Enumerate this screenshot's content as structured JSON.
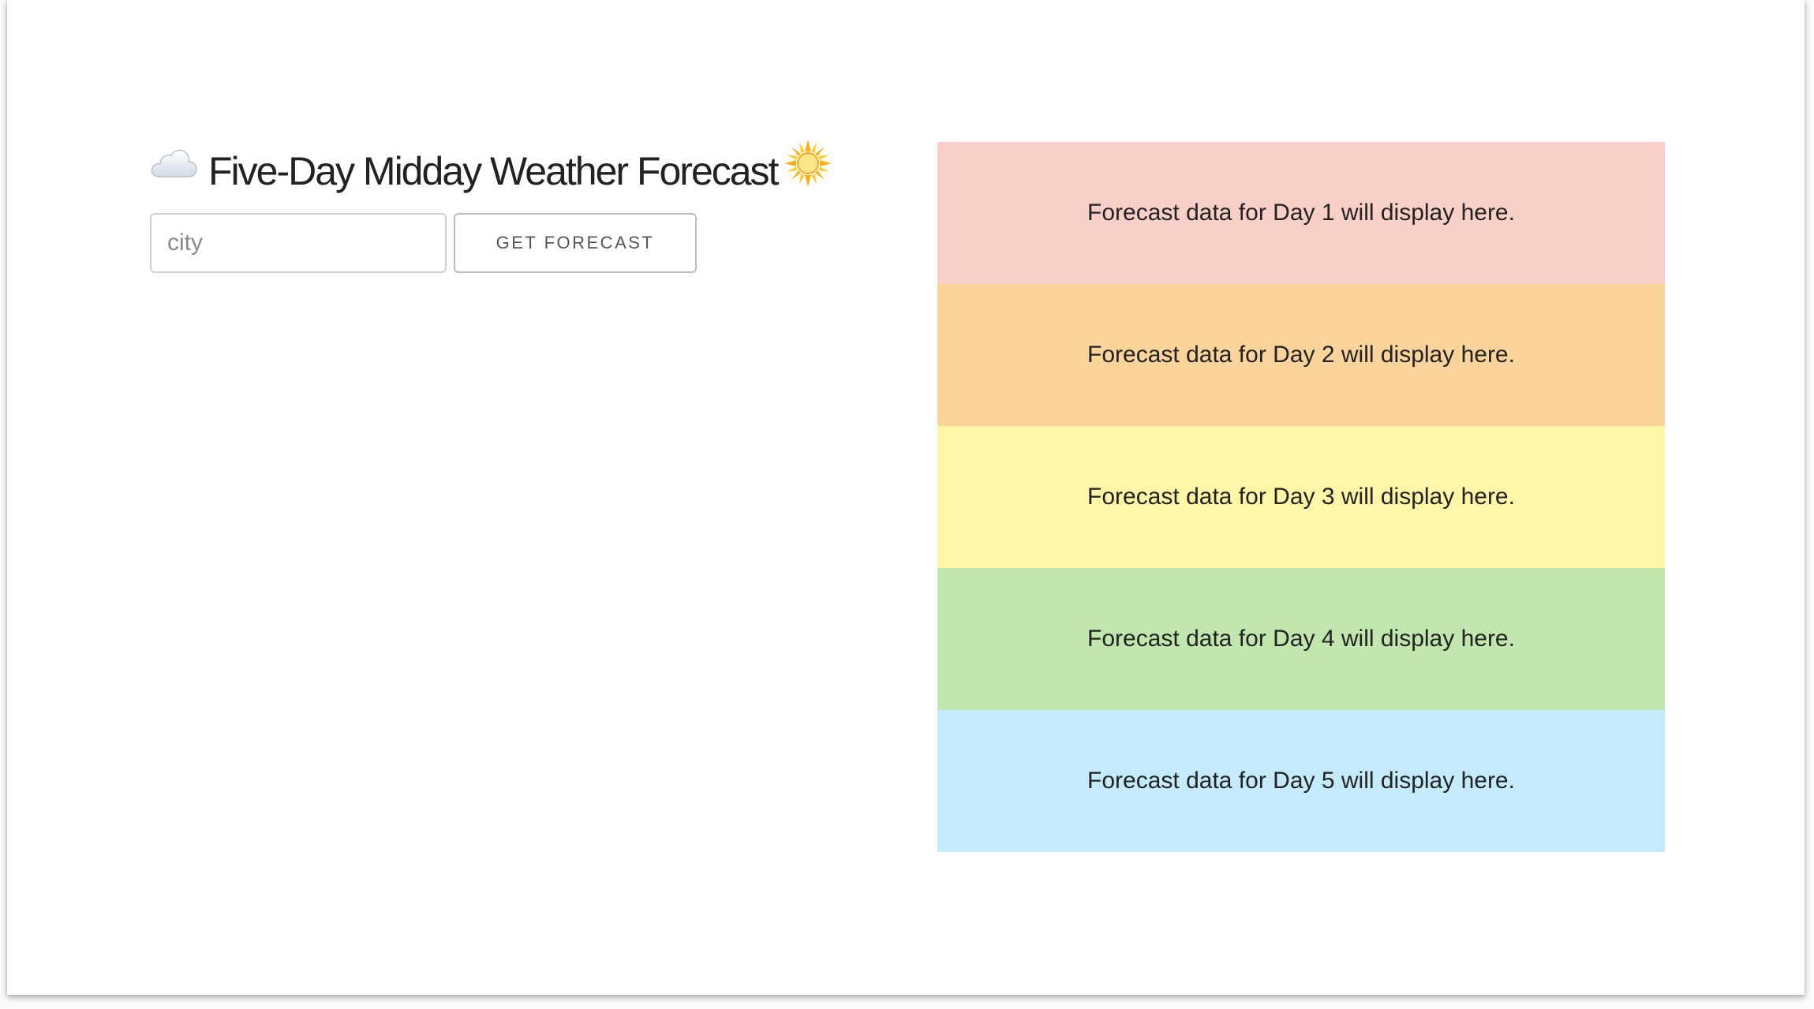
{
  "header": {
    "title": "Five-Day Midday Weather Forecast",
    "leading_icon": "cloud-icon",
    "trailing_icon": "sun-icon"
  },
  "search": {
    "placeholder": "city",
    "value": "",
    "button_label": "GET FORECAST"
  },
  "forecast": {
    "days": [
      {
        "label": "Forecast data for Day 1 will display here.",
        "color": "#f8d0c8"
      },
      {
        "label": "Forecast data for Day 2 will display here.",
        "color": "#fbd49c"
      },
      {
        "label": "Forecast data for Day 3 will display here.",
        "color": "#fff6a8"
      },
      {
        "label": "Forecast data for Day 4 will display here.",
        "color": "#c2e7ae"
      },
      {
        "label": "Forecast data for Day 5 will display here.",
        "color": "#c4ebfb"
      }
    ]
  }
}
